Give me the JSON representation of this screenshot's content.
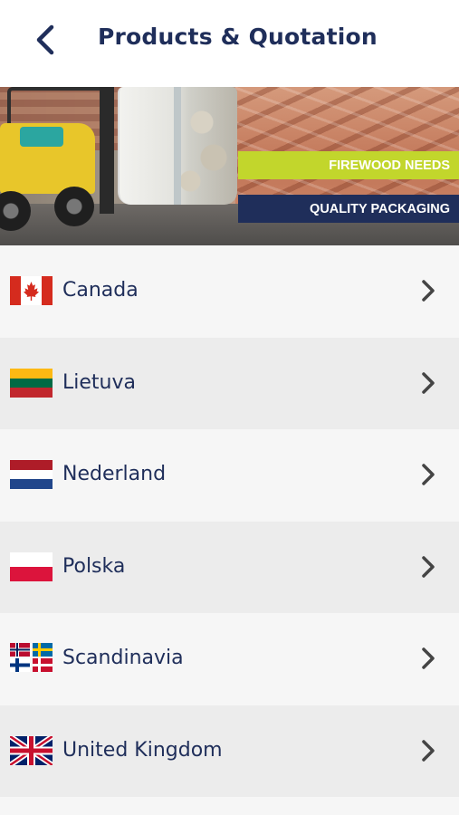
{
  "header": {
    "title": "Products & Quotation",
    "back_icon": "chevron-left-icon"
  },
  "banner": {
    "ribbon_top": "FIREWOOD NEEDS",
    "ribbon_bottom": "QUALITY PACKAGING",
    "colors": {
      "green": "#c2d62c",
      "navy": "#1f2e5a"
    }
  },
  "countries": [
    {
      "label": "Canada",
      "flag": "canada-flag-icon"
    },
    {
      "label": "Lietuva",
      "flag": "lithuania-flag-icon"
    },
    {
      "label": "Nederland",
      "flag": "netherlands-flag-icon"
    },
    {
      "label": "Polska",
      "flag": "poland-flag-icon"
    },
    {
      "label": "Scandinavia",
      "flag": "scandinavia-flags-icon"
    },
    {
      "label": "United Kingdom",
      "flag": "uk-flag-icon"
    }
  ],
  "colors": {
    "text": "#1f2e5a",
    "chevron": "#444444"
  }
}
